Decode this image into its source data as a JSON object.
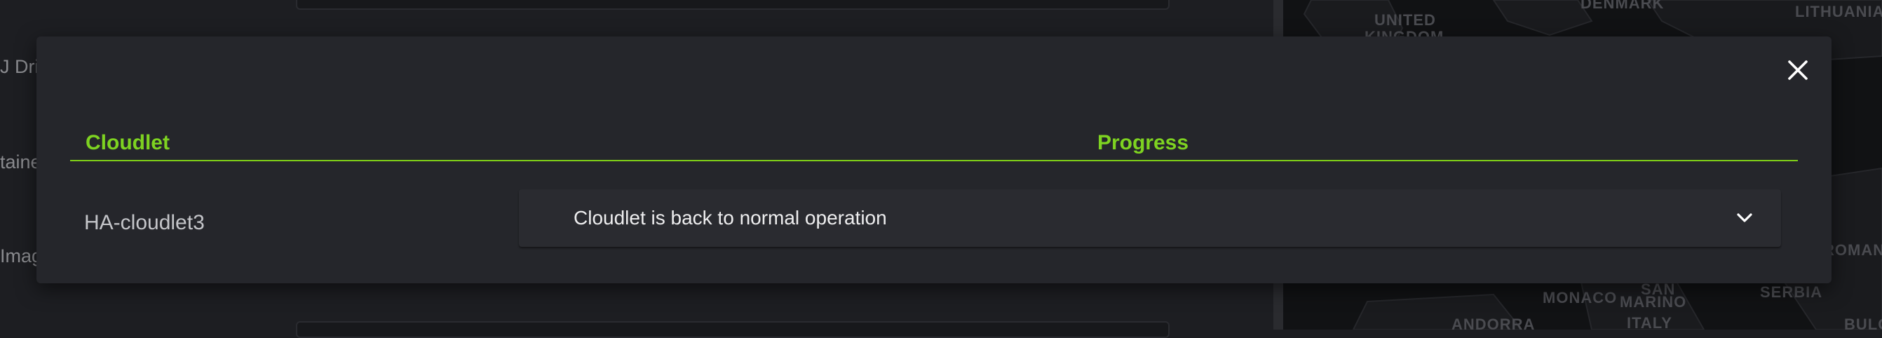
{
  "background": {
    "labels": [
      "J Driv",
      "taine",
      "Imag"
    ],
    "map_labels": [
      "UNITED",
      "KINGDOM",
      "DENMARK",
      "LITHUANIA",
      "ROMANI",
      "MONACO",
      "SAN",
      "MARINO",
      "SERBIA",
      "ANDORRA",
      "ITALY",
      "BULG"
    ]
  },
  "modal": {
    "close_icon": "close-icon",
    "table": {
      "columns": [
        "Cloudlet",
        "Progress"
      ],
      "rows": [
        {
          "cloudlet": "HA-cloudlet3",
          "progress": "Cloudlet is back to normal operation",
          "expand_icon": "chevron-down-icon"
        }
      ]
    }
  },
  "colors": {
    "accent": "#7ed321",
    "modal_bg": "#25262b",
    "page_bg": "#1c1d21"
  }
}
